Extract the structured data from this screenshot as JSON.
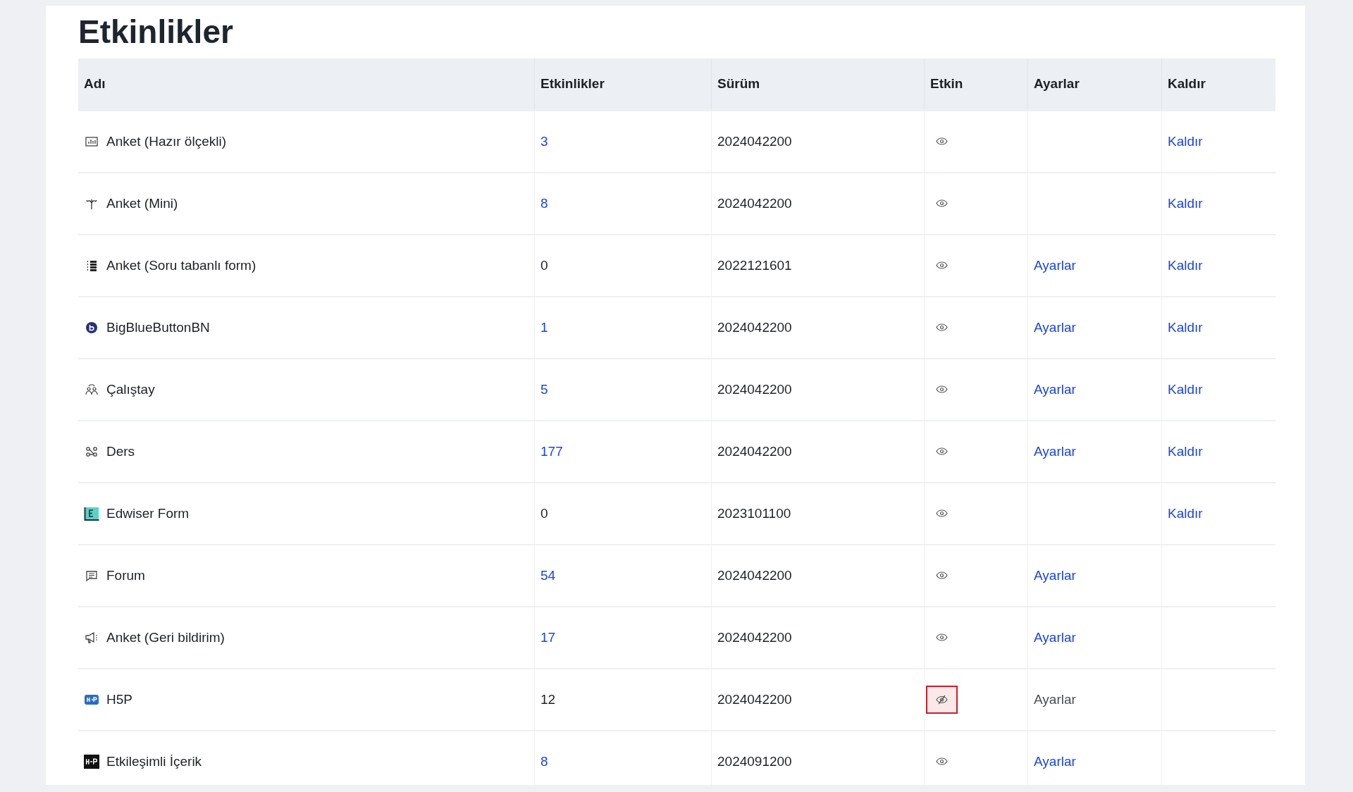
{
  "title": "Etkinlikler",
  "columns": [
    "Adı",
    "Etkinlikler",
    "Sürüm",
    "Etkin",
    "Ayarlar",
    "Kaldır"
  ],
  "rows": [
    {
      "kind": "scale",
      "name": "Anket (Hazır ölçekli)",
      "count": "3",
      "count_link": true,
      "version": "2024042200",
      "enabled": true,
      "highlighted": false,
      "settings": null,
      "remove": "Kaldır"
    },
    {
      "kind": "mini",
      "name": "Anket (Mini)",
      "count": "8",
      "count_link": true,
      "version": "2024042200",
      "enabled": true,
      "highlighted": false,
      "settings": null,
      "remove": "Kaldır"
    },
    {
      "kind": "list",
      "name": "Anket (Soru tabanlı form)",
      "count": "0",
      "count_link": false,
      "version": "2022121601",
      "enabled": true,
      "highlighted": false,
      "settings": {
        "label": "Ayarlar",
        "disabled": false
      },
      "remove": "Kaldır"
    },
    {
      "kind": "bbb",
      "name": "BigBlueButtonBN",
      "count": "1",
      "count_link": true,
      "version": "2024042200",
      "enabled": true,
      "highlighted": false,
      "settings": {
        "label": "Ayarlar",
        "disabled": false
      },
      "remove": "Kaldır"
    },
    {
      "kind": "workshop",
      "name": "Çalıştay",
      "count": "5",
      "count_link": true,
      "version": "2024042200",
      "enabled": true,
      "highlighted": false,
      "settings": {
        "label": "Ayarlar",
        "disabled": false
      },
      "remove": "Kaldır"
    },
    {
      "kind": "lesson",
      "name": "Ders",
      "count": "177",
      "count_link": true,
      "version": "2024042200",
      "enabled": true,
      "highlighted": false,
      "settings": {
        "label": "Ayarlar",
        "disabled": false
      },
      "remove": "Kaldır"
    },
    {
      "kind": "edwiser",
      "name": "Edwiser Form",
      "count": "0",
      "count_link": false,
      "version": "2023101100",
      "enabled": true,
      "highlighted": false,
      "settings": null,
      "remove": "Kaldır"
    },
    {
      "kind": "forum",
      "name": "Forum",
      "count": "54",
      "count_link": true,
      "version": "2024042200",
      "enabled": true,
      "highlighted": false,
      "settings": {
        "label": "Ayarlar",
        "disabled": false
      },
      "remove": null
    },
    {
      "kind": "feedback",
      "name": "Anket (Geri bildirim)",
      "count": "17",
      "count_link": true,
      "version": "2024042200",
      "enabled": true,
      "highlighted": false,
      "settings": {
        "label": "Ayarlar",
        "disabled": false
      },
      "remove": null
    },
    {
      "kind": "h5p",
      "name": "H5P",
      "count": "12",
      "count_link": false,
      "version": "2024042200",
      "enabled": false,
      "highlighted": true,
      "settings": {
        "label": "Ayarlar",
        "disabled": true
      },
      "remove": null
    },
    {
      "kind": "h5p-dark",
      "name": "Etkileşimli İçerik",
      "count": "8",
      "count_link": true,
      "version": "2024091200",
      "enabled": true,
      "highlighted": false,
      "settings": {
        "label": "Ayarlar",
        "disabled": false
      },
      "remove": null
    }
  ]
}
